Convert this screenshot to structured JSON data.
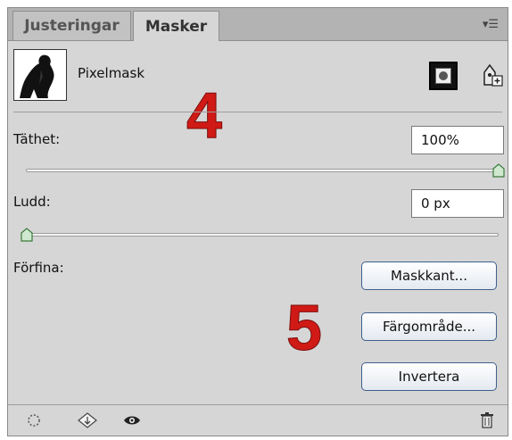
{
  "tabs": [
    {
      "label": "Justeringar",
      "active": false
    },
    {
      "label": "Masker",
      "active": true
    }
  ],
  "panel_menu_icon": "panel-menu-icon",
  "mask": {
    "type_label": "Pixelmask",
    "thumbnail_icon": "mask-thumbnail",
    "pixel_mask_button_icon": "pixel-mask-icon",
    "vector_mask_button_icon": "vector-mask-icon"
  },
  "density": {
    "label": "Täthet:",
    "value": "100%",
    "slider_fraction": 1.0
  },
  "feather": {
    "label": "Ludd:",
    "value": "0 px",
    "slider_fraction": 0.0
  },
  "refine": {
    "label": "Förfina:",
    "buttons": [
      "Maskkant...",
      "Färgområde...",
      "Invertera"
    ]
  },
  "annotations": [
    "4",
    "5"
  ],
  "bottom_icons": [
    "load-selection-icon",
    "apply-mask-icon",
    "visibility-eye-icon",
    "trash-icon"
  ],
  "colors": {
    "panel_bg": "#d6d6d6",
    "tab_bar_bg": "#b3b3b3",
    "annotation_red": "#d01a16",
    "button_border": "#3d5f8c"
  }
}
